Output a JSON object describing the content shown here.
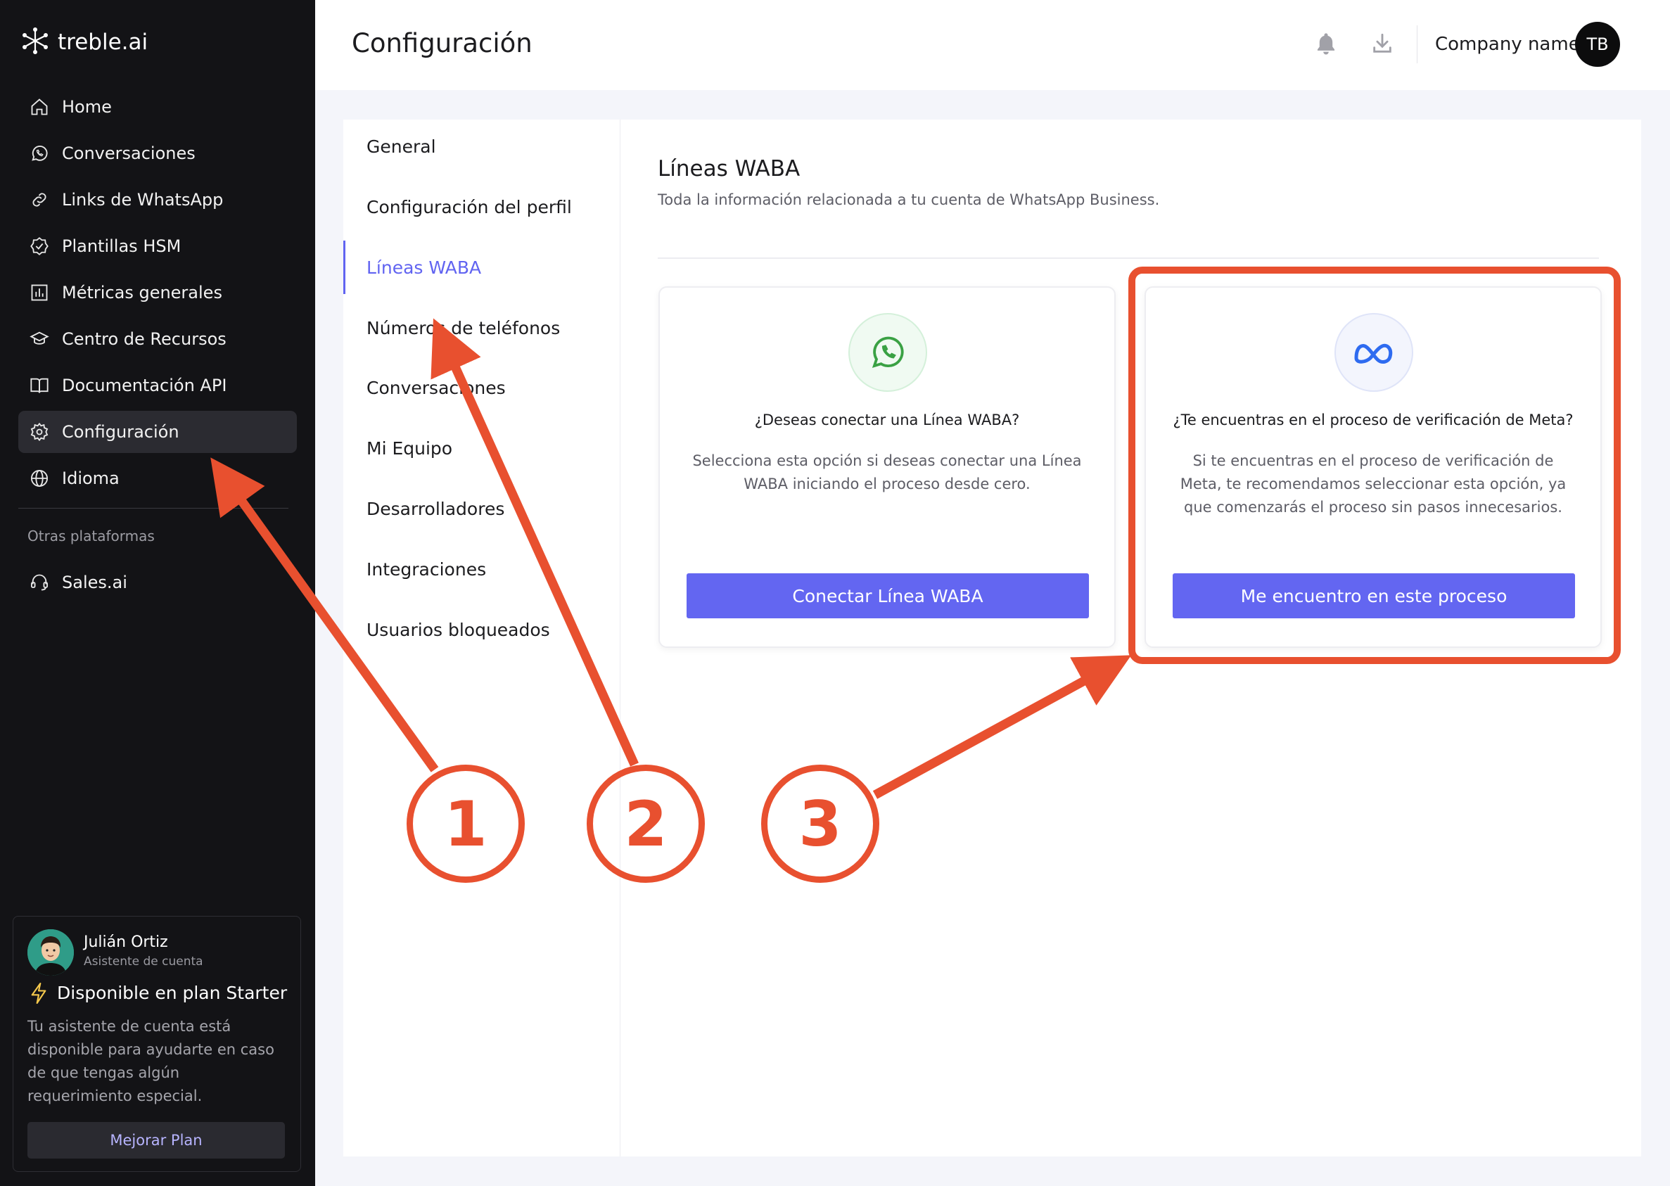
{
  "app": {
    "logo_text": "treble.ai",
    "brand_color": "#6366f1",
    "annotation_color": "#e8502f"
  },
  "sidebar": {
    "items": [
      {
        "label": "Home",
        "icon": "home-icon"
      },
      {
        "label": "Conversaciones",
        "icon": "whatsapp-icon"
      },
      {
        "label": "Links de WhatsApp",
        "icon": "link-icon"
      },
      {
        "label": "Plantillas HSM",
        "icon": "badge-check-icon"
      },
      {
        "label": "Métricas generales",
        "icon": "bar-chart-icon"
      },
      {
        "label": "Centro de Recursos",
        "icon": "graduation-cap-icon"
      },
      {
        "label": "Documentación API",
        "icon": "book-icon"
      },
      {
        "label": "Configuración",
        "icon": "gear-icon",
        "active": true
      },
      {
        "label": "Idioma",
        "icon": "globe-icon"
      }
    ],
    "other_title": "Otras plataformas",
    "other_items": [
      {
        "label": "Sales.ai",
        "icon": "headset-icon"
      }
    ]
  },
  "assistant": {
    "name": "Julián Ortiz",
    "role": "Asistente de cuenta",
    "plan_title": "Disponible en plan Starter",
    "description": "Tu asistente de cuenta está disponible para ayudarte en caso de que tengas algún requerimiento especial.",
    "button": "Mejorar Plan"
  },
  "header": {
    "title": "Configuración",
    "company": "Company name",
    "avatar_initials": "TB"
  },
  "subnav": {
    "items": [
      "General",
      "Configuración del perfil",
      "Líneas WABA",
      "Números de teléfonos",
      "Conversaciones",
      "Mi Equipo",
      "Desarrolladores",
      "Integraciones",
      "Usuarios bloqueados"
    ],
    "active": "Líneas WABA"
  },
  "section": {
    "title": "Líneas WABA",
    "subtitle": "Toda la información relacionada a tu cuenta de WhatsApp Business."
  },
  "cards": [
    {
      "icon": "whatsapp-icon",
      "question": "¿Deseas conectar una Línea WABA?",
      "description": "Selecciona esta opción si deseas conectar una Línea WABA iniciando el proceso desde cero.",
      "button": "Conectar Línea WABA"
    },
    {
      "icon": "meta-icon",
      "question": "¿Te encuentras en el proceso de verificación de Meta?",
      "description": "Si te encuentras en el proceso de verificación de Meta, te recomendamos seleccionar esta opción, ya que comenzarás el proceso sin pasos innecesarios.",
      "button": "Me encuentro en este proceso"
    }
  ],
  "annotations": {
    "steps": [
      "1",
      "2",
      "3"
    ]
  }
}
